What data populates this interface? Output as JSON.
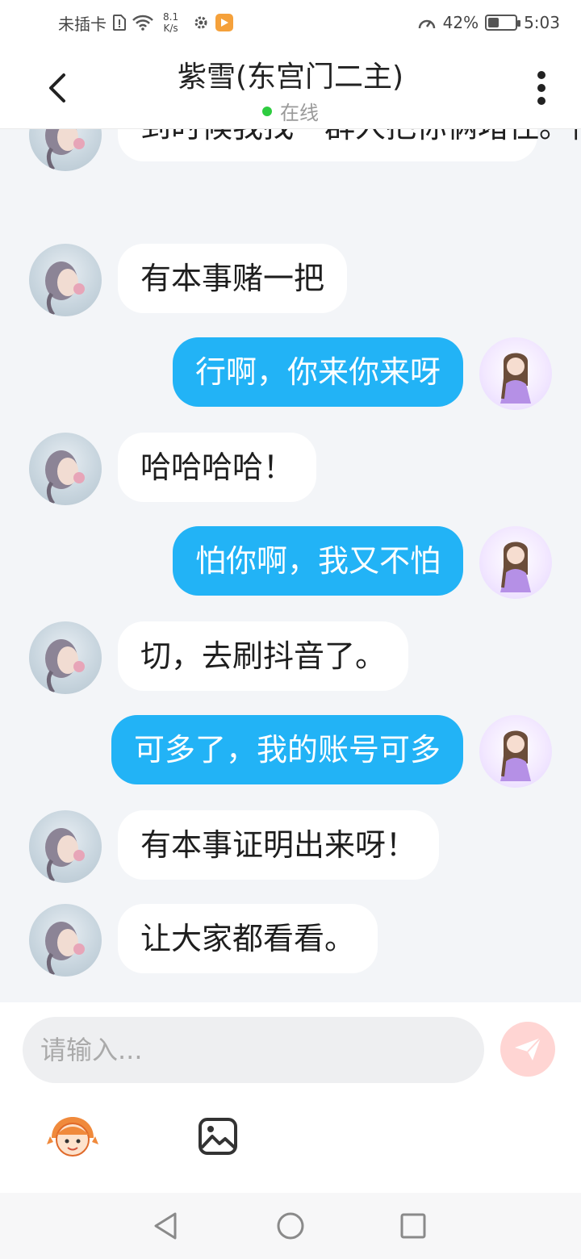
{
  "status_bar": {
    "carrier": "未插卡",
    "speed_value": "8.1",
    "speed_unit": "K/s",
    "battery_percent": "42%",
    "time": "5:03",
    "battery_level": 0.42,
    "icons": [
      "sim-icon",
      "wifi-icon",
      "settings-icon",
      "app-notification-icon",
      "data-saver-icon",
      "battery-icon"
    ]
  },
  "header": {
    "title": "紫雪(东宫门二主)",
    "status": "在线",
    "status_color": "#2ecc40"
  },
  "messages": [
    {
      "side": "left",
      "text": "到时候我找一群人把你俩堵住。信不信？"
    },
    {
      "side": "left",
      "text": "有本事赌一把"
    },
    {
      "side": "right",
      "text": "行啊，你来你来呀"
    },
    {
      "side": "left",
      "text": "哈哈哈哈！"
    },
    {
      "side": "right",
      "text": "怕你啊，我又不怕"
    },
    {
      "side": "left",
      "text": "切，去刷抖音了。"
    },
    {
      "side": "right",
      "text": "可多了，我的账号可多"
    },
    {
      "side": "left",
      "text": "有本事证明出来呀！"
    },
    {
      "side": "left",
      "text": "让大家都看看。"
    }
  ],
  "input": {
    "placeholder": "请输入..."
  },
  "colors": {
    "sent_bubble": "#22b3f6",
    "received_bubble": "#ffffff",
    "chat_background": "#f3f5f8",
    "send_button": "#ffd5d3"
  }
}
